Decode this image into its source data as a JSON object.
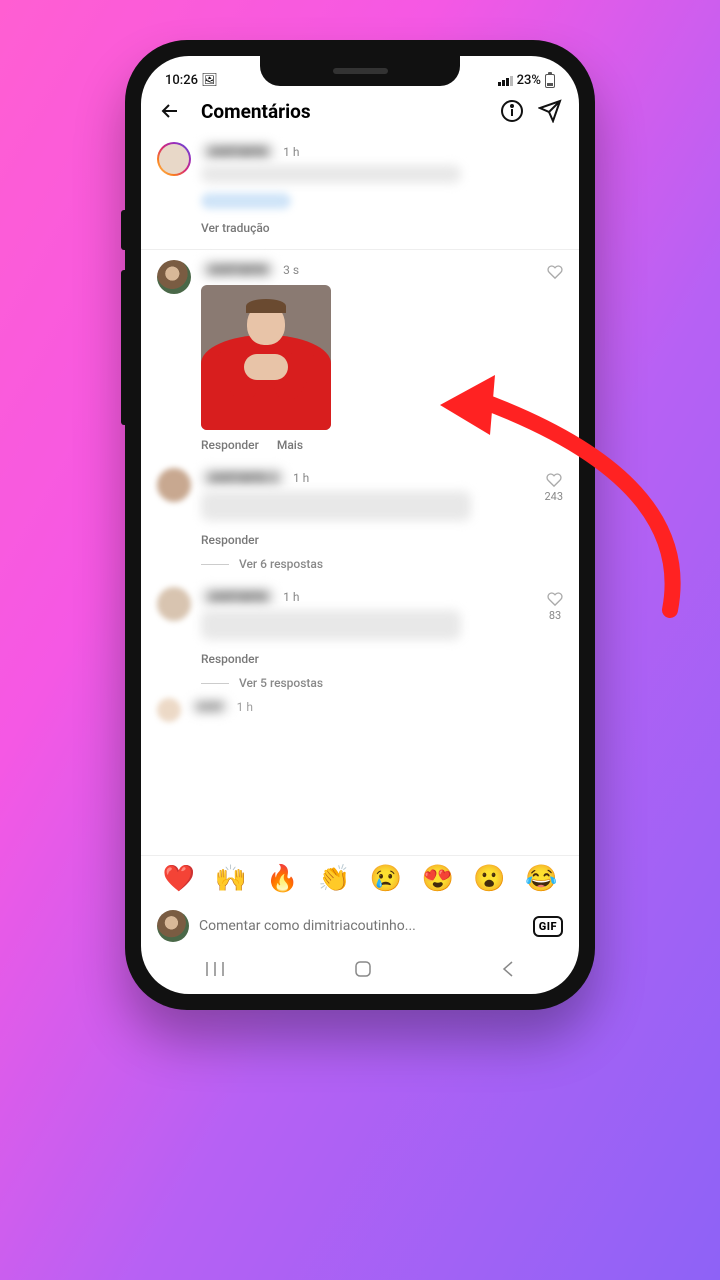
{
  "status": {
    "time": "10:26",
    "battery": "23%"
  },
  "header": {
    "title": "Comentários"
  },
  "comments": [
    {
      "time": "1 h",
      "translate": "Ver tradução"
    },
    {
      "time": "3 s",
      "reply": "Responder",
      "more": "Mais"
    },
    {
      "time": "1 h",
      "reply": "Responder",
      "likes": "243",
      "view_replies": "Ver 6 respostas"
    },
    {
      "time": "1 h",
      "reply": "Responder",
      "likes": "83",
      "view_replies": "Ver 5 respostas"
    },
    {
      "time": "1 h"
    }
  ],
  "emojis": [
    "❤️",
    "🙌",
    "🔥",
    "👏",
    "😢",
    "😍",
    "😮",
    "😂"
  ],
  "input": {
    "placeholder": "Comentar como dimitriacoutinho...",
    "gif": "GIF"
  }
}
